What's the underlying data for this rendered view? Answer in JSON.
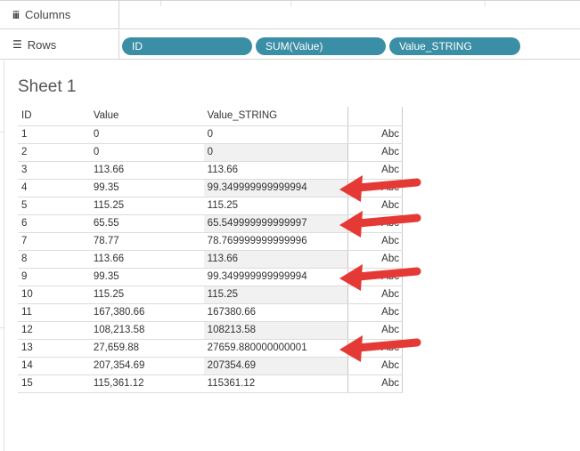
{
  "shelves": {
    "columns": {
      "label": "Columns",
      "icon": "columns-shelf-icon",
      "pills": []
    },
    "rows": {
      "label": "Rows",
      "icon": "rows-shelf-icon",
      "pills": [
        "ID",
        "SUM(Value)",
        "Value_STRING"
      ]
    }
  },
  "sheet": {
    "title": "Sheet 1",
    "headers": [
      "ID",
      "Value",
      "Value_STRING",
      ""
    ],
    "rows": [
      {
        "id": "1",
        "value": "0",
        "value_string": "0",
        "mark": "Abc"
      },
      {
        "id": "2",
        "value": "0",
        "value_string": "0",
        "mark": "Abc"
      },
      {
        "id": "3",
        "value": "113.66",
        "value_string": "113.66",
        "mark": "Abc"
      },
      {
        "id": "4",
        "value": "99.35",
        "value_string": "99.349999999999994",
        "mark": "Abc"
      },
      {
        "id": "5",
        "value": "115.25",
        "value_string": "115.25",
        "mark": "Abc"
      },
      {
        "id": "6",
        "value": "65.55",
        "value_string": "65.549999999999997",
        "mark": "Abc"
      },
      {
        "id": "7",
        "value": "78.77",
        "value_string": "78.769999999999996",
        "mark": "Abc"
      },
      {
        "id": "8",
        "value": "113.66",
        "value_string": "113.66",
        "mark": "Abc"
      },
      {
        "id": "9",
        "value": "99.35",
        "value_string": "99.349999999999994",
        "mark": "Abc"
      },
      {
        "id": "10",
        "value": "115.25",
        "value_string": "115.25",
        "mark": "Abc"
      },
      {
        "id": "11",
        "value": "167,380.66",
        "value_string": "167380.66",
        "mark": "Abc"
      },
      {
        "id": "12",
        "value": "108,213.58",
        "value_string": "108213.58",
        "mark": "Abc"
      },
      {
        "id": "13",
        "value": "27,659.88",
        "value_string": "27659.880000000001",
        "mark": "Abc"
      },
      {
        "id": "14",
        "value": "207,354.69",
        "value_string": "207354.69",
        "mark": "Abc"
      },
      {
        "id": "15",
        "value": "115,361.12",
        "value_string": "115361.12",
        "mark": "Abc"
      }
    ]
  },
  "annotations": {
    "arrow_color": "#e53935",
    "arrows_point_to_rows": [
      "4",
      "6",
      "9",
      "13"
    ]
  },
  "colors": {
    "pill": "#3a8ea5",
    "band": "#f1f1f1"
  }
}
